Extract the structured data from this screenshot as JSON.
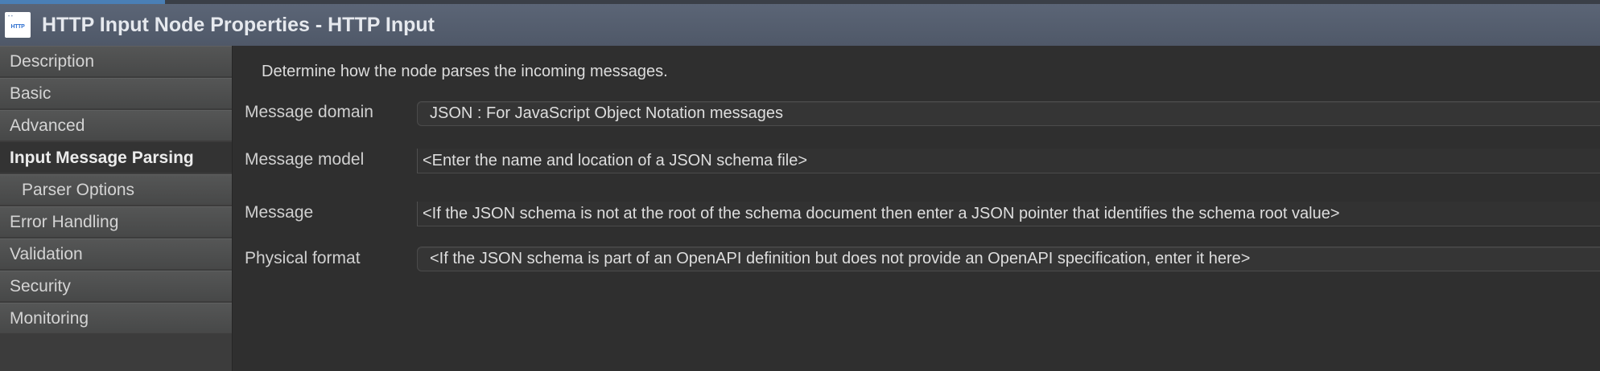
{
  "window": {
    "title": "HTTP Input Node Properties - HTTP Input",
    "icon_label": "HTTP",
    "icon_name": "http-node-icon"
  },
  "sidebar": {
    "items": [
      {
        "label": "Description"
      },
      {
        "label": "Basic"
      },
      {
        "label": "Advanced"
      },
      {
        "label": "Input Message Parsing",
        "active": true
      },
      {
        "label": "Parser Options",
        "sub": true
      },
      {
        "label": "Error Handling"
      },
      {
        "label": "Validation"
      },
      {
        "label": "Security"
      },
      {
        "label": "Monitoring"
      }
    ]
  },
  "main": {
    "description": "Determine how the node parses the incoming messages.",
    "fields": [
      {
        "label": "Message domain",
        "value": "JSON : For JavaScript Object Notation messages"
      },
      {
        "label": "Message model",
        "value": "<Enter the name and location of a JSON schema file>"
      },
      {
        "label": "Message",
        "value": "<If the JSON schema is not at the root of the schema document then enter a JSON pointer that identifies the schema root value>"
      },
      {
        "label": "Physical format",
        "value": "<If the JSON schema is part of an OpenAPI definition but does not provide an OpenAPI specification, enter it here>"
      }
    ]
  }
}
